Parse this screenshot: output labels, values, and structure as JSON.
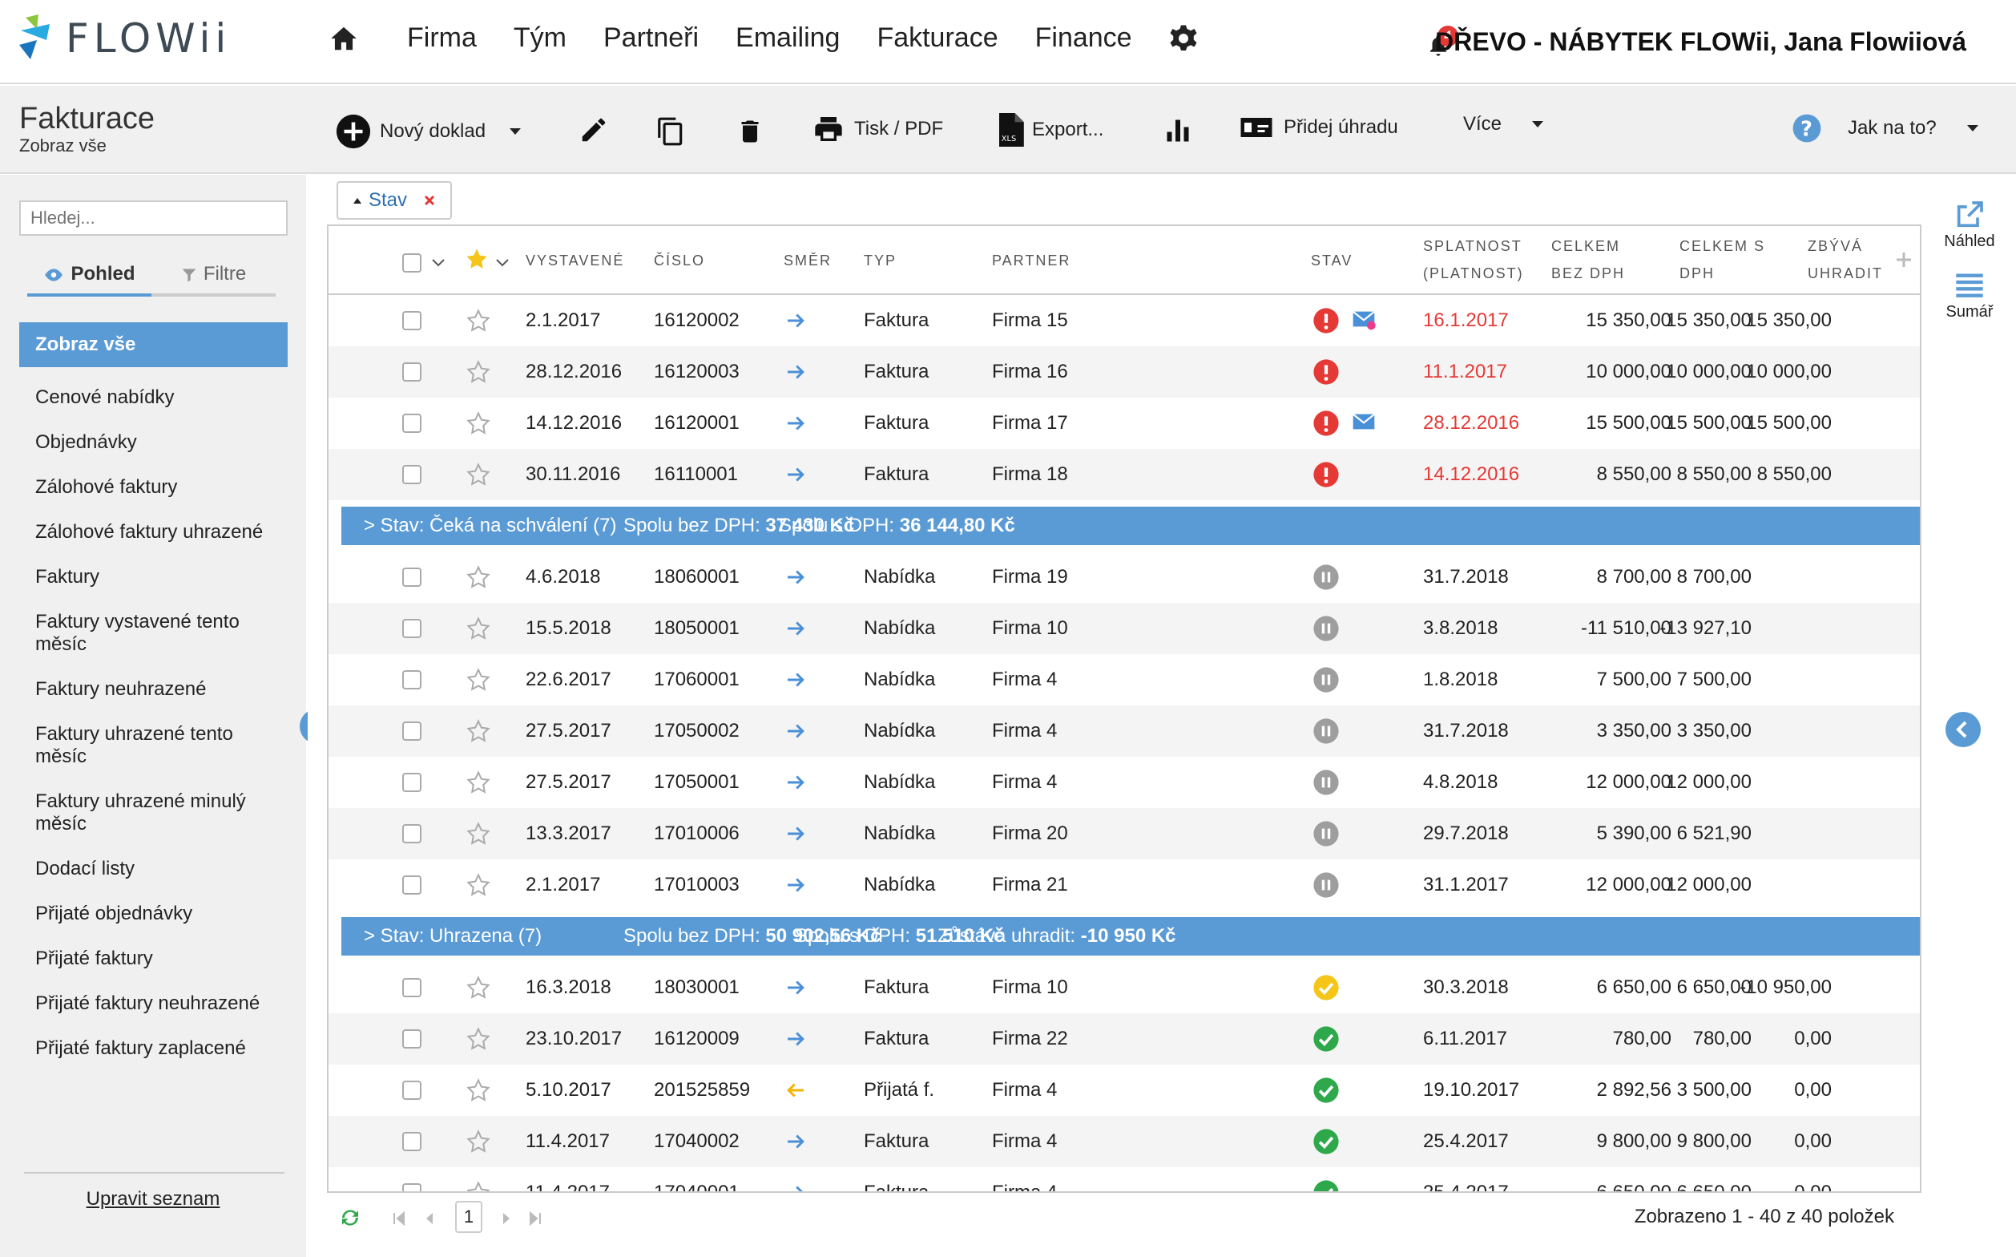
{
  "app": {
    "logo": "FLOWii",
    "company": "DŘEVO - NÁBYTEK FLOWii, Jana Flowiiová",
    "notifications": "4"
  },
  "topnav": [
    "Firma",
    "Tým",
    "Partneři",
    "Emailing",
    "Fakturace",
    "Finance"
  ],
  "page": {
    "title": "Fakturace",
    "subtitle": "Zobraz vše"
  },
  "toolbar": {
    "new_doc": "Nový doklad",
    "print": "Tisk / PDF",
    "export": "Export...",
    "add_payment": "Přidej úhradu",
    "more": "Více",
    "help": "Jak na to?"
  },
  "sidebar": {
    "search_placeholder": "Hledej...",
    "tab_view": "Pohled",
    "tab_filter": "Filtre",
    "items": [
      "Zobraz vše",
      "Cenové nabídky",
      "Objednávky",
      "Zálohové faktury",
      "Zálohové faktury uhrazené",
      "Faktury",
      "Faktury vystavené tento měsíc",
      "Faktury neuhrazené",
      "Faktury uhrazené tento měsíc",
      "Faktury uhrazené minulý měsíc",
      "Dodací listy",
      "Přijaté objednávky",
      "Přijaté faktury",
      "Přijaté faktury neuhrazené",
      "Přijaté faktury zaplacené"
    ],
    "edit_list": "Upravit seznam"
  },
  "filter_chip": "Stav",
  "columns": {
    "issued": "VYSTAVENÉ",
    "number": "ČÍSLO",
    "direction": "SMĚR",
    "type": "TYP",
    "partner": "PARTNER",
    "status": "STAV",
    "due1": "SPLATNOST",
    "due2": "(PLATNOST)",
    "net1": "CELKEM",
    "net2": "BEZ DPH",
    "gross1": "CELKEM S",
    "gross2": "DPH",
    "remain1": "ZBÝVÁ",
    "remain2": "UHRADIT"
  },
  "rows_overdue": [
    {
      "date": "2.1.2017",
      "number": "16120002",
      "dir": "out",
      "type": "Faktura",
      "partner": "Firma 15",
      "status": "overdue",
      "mail": "read",
      "due": "16.1.2017",
      "net": "15 350,00",
      "gross": "15 350,00",
      "remain": "15 350,00"
    },
    {
      "date": "28.12.2016",
      "number": "16120003",
      "dir": "out",
      "type": "Faktura",
      "partner": "Firma 16",
      "status": "overdue",
      "mail": "",
      "due": "11.1.2017",
      "net": "10 000,00",
      "gross": "10 000,00",
      "remain": "10 000,00"
    },
    {
      "date": "14.12.2016",
      "number": "16120001",
      "dir": "out",
      "type": "Faktura",
      "partner": "Firma 17",
      "status": "overdue",
      "mail": "sent",
      "due": "28.12.2016",
      "net": "15 500,00",
      "gross": "15 500,00",
      "remain": "15 500,00"
    },
    {
      "date": "30.11.2016",
      "number": "16110001",
      "dir": "out",
      "type": "Faktura",
      "partner": "Firma 18",
      "status": "overdue",
      "mail": "",
      "due": "14.12.2016",
      "net": "8 550,00",
      "gross": "8 550,00",
      "remain": "8 550,00"
    }
  ],
  "group1": {
    "label": "Stav: Čeká na schválení (7)",
    "net_label": "Spolu bez DPH:",
    "net": "37 430 Kč",
    "gross_label": "Spolu s DPH:",
    "gross": "36 144,80 Kč"
  },
  "rows_pending": [
    {
      "date": "4.6.2018",
      "number": "18060001",
      "type": "Nabídka",
      "partner": "Firma 19",
      "due": "31.7.2018",
      "net": "8 700,00",
      "gross": "8 700,00"
    },
    {
      "date": "15.5.2018",
      "number": "18050001",
      "type": "Nabídka",
      "partner": "Firma 10",
      "due": "3.8.2018",
      "net": "-11 510,00",
      "gross": "-13 927,10"
    },
    {
      "date": "22.6.2017",
      "number": "17060001",
      "type": "Nabídka",
      "partner": "Firma 4",
      "due": "1.8.2018",
      "net": "7 500,00",
      "gross": "7 500,00"
    },
    {
      "date": "27.5.2017",
      "number": "17050002",
      "type": "Nabídka",
      "partner": "Firma 4",
      "due": "31.7.2018",
      "net": "3 350,00",
      "gross": "3 350,00"
    },
    {
      "date": "27.5.2017",
      "number": "17050001",
      "type": "Nabídka",
      "partner": "Firma 4",
      "due": "4.8.2018",
      "net": "12 000,00",
      "gross": "12 000,00"
    },
    {
      "date": "13.3.2017",
      "number": "17010006",
      "type": "Nabídka",
      "partner": "Firma 20",
      "due": "29.7.2018",
      "net": "5 390,00",
      "gross": "6 521,90"
    },
    {
      "date": "2.1.2017",
      "number": "17010003",
      "type": "Nabídka",
      "partner": "Firma 21",
      "due": "31.1.2017",
      "net": "12 000,00",
      "gross": "12 000,00"
    }
  ],
  "group2": {
    "label": "Stav: Uhrazena (7)",
    "net_label": "Spolu bez DPH:",
    "net": "50 902,56 Kč",
    "gross_label": "Spolu s DPH:",
    "gross": "51 510 Kč",
    "remain_label": "Zůstává uhradit:",
    "remain": "-10 950 Kč"
  },
  "rows_paid": [
    {
      "date": "16.3.2018",
      "number": "18030001",
      "dir": "out",
      "type": "Faktura",
      "partner": "Firma 10",
      "status": "partial",
      "due": "30.3.2018",
      "net": "6 650,00",
      "gross": "6 650,00",
      "remain": "-10 950,00"
    },
    {
      "date": "23.10.2017",
      "number": "16120009",
      "dir": "out",
      "type": "Faktura",
      "partner": "Firma 22",
      "status": "paid",
      "due": "6.11.2017",
      "net": "780,00",
      "gross": "780,00",
      "remain": "0,00"
    },
    {
      "date": "5.10.2017",
      "number": "201525859",
      "dir": "in",
      "type": "Přijatá f.",
      "partner": "Firma 4",
      "status": "paid",
      "due": "19.10.2017",
      "net": "2 892,56",
      "gross": "3 500,00",
      "remain": "0,00"
    },
    {
      "date": "11.4.2017",
      "number": "17040002",
      "dir": "out",
      "type": "Faktura",
      "partner": "Firma 4",
      "status": "paid",
      "due": "25.4.2017",
      "net": "9 800,00",
      "gross": "9 800,00",
      "remain": "0,00"
    },
    {
      "date": "11.4.2017",
      "number": "17040001",
      "dir": "out",
      "type": "Faktura",
      "partner": "Firma 4",
      "status": "paid",
      "due": "25.4.2017",
      "net": "6 650,00",
      "gross": "6 650,00",
      "remain": "0,00"
    }
  ],
  "pager": {
    "page": "1",
    "count": "Zobrazeno 1 - 40 z 40 položek"
  },
  "rightpanel": {
    "preview": "Náhled",
    "summary": "Sumář"
  },
  "colors": {
    "accent": "#5b9bd5",
    "overdue": "#e53935",
    "paid": "#2ea84a",
    "partial": "#f5c518",
    "pending": "#9e9e9e",
    "arrow_out": "#4a90d9",
    "arrow_in": "#f5b400"
  }
}
